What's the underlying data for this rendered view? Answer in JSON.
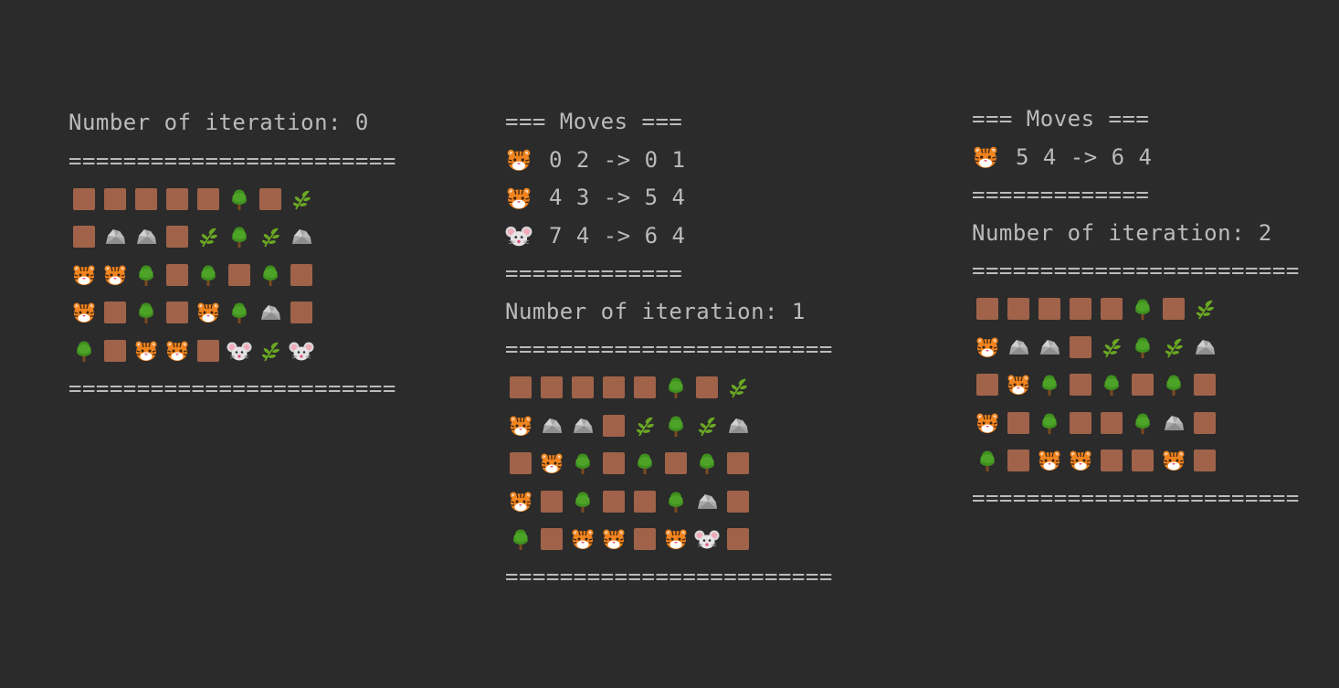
{
  "legend": {
    "S": "soil-tile",
    "T": "tree",
    "R": "rock",
    "P": "plant-sprout",
    "G": "tiger-face",
    "M": "mouse-face"
  },
  "icons": {
    "S": "soil-tile-icon",
    "T": "tree-icon",
    "R": "rock-icon",
    "P": "plant-sprout-icon",
    "G": "tiger-face-icon",
    "M": "mouse-face-icon"
  },
  "colors": {
    "background": "#2b2b2b",
    "text": "#bbbbbb",
    "soil": "#a0634a",
    "tree": "#3f8f1f",
    "plant": "#6aa823",
    "rock": "#a8a8a8",
    "tiger": "#f0841f",
    "mouse": "#e6e3e6"
  },
  "panels": [
    {
      "lines": [
        {
          "kind": "text",
          "text": "Number of iteration: 0"
        },
        {
          "kind": "text",
          "text": "========================"
        },
        {
          "kind": "grid",
          "row": "SSSSSTSP"
        },
        {
          "kind": "grid",
          "row": "SRRSPTPR"
        },
        {
          "kind": "grid",
          "row": "GGTSTSTS"
        },
        {
          "kind": "grid",
          "row": "GSTSGTRS"
        },
        {
          "kind": "grid",
          "row": "TSGGSMPM"
        },
        {
          "kind": "text",
          "text": "========================"
        }
      ]
    },
    {
      "lines": [
        {
          "kind": "text",
          "text": "=== Moves ==="
        },
        {
          "kind": "move",
          "icon": "G",
          "text": "0 2 -> 0 1"
        },
        {
          "kind": "move",
          "icon": "G",
          "text": "4 3 -> 5 4"
        },
        {
          "kind": "move",
          "icon": "M",
          "text": "7 4 -> 6 4"
        },
        {
          "kind": "text",
          "text": "============="
        },
        {
          "kind": "text",
          "text": "Number of iteration: 1"
        },
        {
          "kind": "text",
          "text": "========================"
        },
        {
          "kind": "grid",
          "row": "SSSSSTSP"
        },
        {
          "kind": "grid",
          "row": "GRRSPTPR"
        },
        {
          "kind": "grid",
          "row": "SGTSTSTS"
        },
        {
          "kind": "grid",
          "row": "GSTSSTRS"
        },
        {
          "kind": "grid",
          "row": "TSGGSGMS"
        },
        {
          "kind": "text",
          "text": "========================"
        }
      ]
    },
    {
      "lines": [
        {
          "kind": "text",
          "text": "=== Moves ==="
        },
        {
          "kind": "move",
          "icon": "G",
          "text": "5 4 -> 6 4"
        },
        {
          "kind": "text",
          "text": "============="
        },
        {
          "kind": "text",
          "text": "Number of iteration: 2"
        },
        {
          "kind": "text",
          "text": "========================"
        },
        {
          "kind": "grid",
          "row": "SSSSSTSP"
        },
        {
          "kind": "grid",
          "row": "GRRSPTPR"
        },
        {
          "kind": "grid",
          "row": "SGTSTSTS"
        },
        {
          "kind": "grid",
          "row": "GSTSSTRS"
        },
        {
          "kind": "grid",
          "row": "TSGGSSGS"
        },
        {
          "kind": "text",
          "text": "========================"
        }
      ]
    }
  ]
}
